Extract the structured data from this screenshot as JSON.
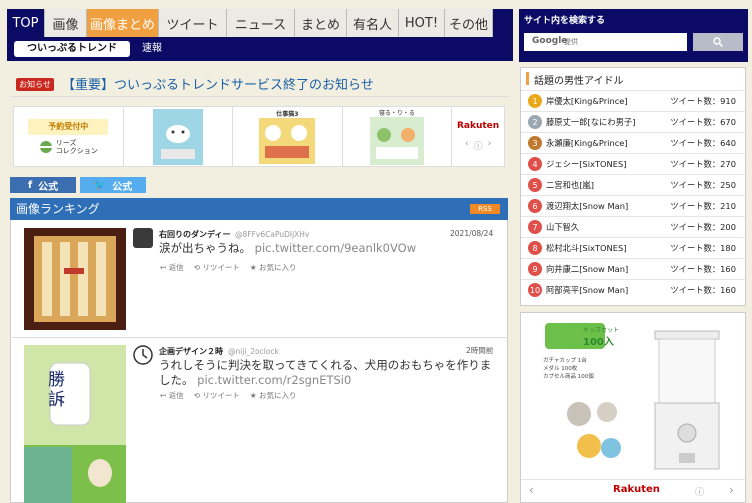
{
  "nav": {
    "tabs": [
      "TOP",
      "画像",
      "画像まとめ",
      "ツイート",
      "ニュース",
      "まとめ",
      "有名人",
      "HOT!",
      "その他"
    ],
    "sub": [
      "ついっぷるトレンド",
      "速報"
    ]
  },
  "notice": {
    "badge": "お知らせ",
    "text": "【重要】ついっぷるトレンドサービス終了のお知らせ"
  },
  "banner": {
    "preorder": "予約受付中",
    "series": "リーズ",
    "collection": "コレクション",
    "rakuten": "Rakuten",
    "card2": "仕事猫3",
    "card4": "寝る・り・る"
  },
  "social": {
    "facebook": "公式",
    "twitter": "公式"
  },
  "ranking": {
    "title": "画像ランキング",
    "rss": "RSS",
    "tweets": [
      {
        "name": "右回りのダンディー",
        "id": "@8FFv6CaPuDIjXHv",
        "date": "2021/08/24",
        "text": "涙が出ちゃうね。",
        "link": "pic.twitter.com/9eanlk0VOw",
        "reply": "返信",
        "retweet": "リツイート",
        "fav": "お気に入り"
      },
      {
        "name": "企画デザイン２時",
        "id": "@niji_2oclock",
        "date": "2時間前",
        "text": "うれしそうに判決を取ってきてくれる、犬用のおもちゃを作りました。",
        "link": "pic.twitter.com/r2sgnETSi0",
        "reply": "返信",
        "retweet": "リツイート",
        "fav": "お気に入り",
        "card_text": "勝訴"
      }
    ]
  },
  "search": {
    "label": "サイト内を検索する",
    "logo": "Google",
    "placeholder": "提供"
  },
  "idols": {
    "title": "話題の男性アイドル",
    "count_label": "ツイート数：",
    "items": [
      {
        "rank": "1",
        "name": "岸優太[King&Prince]",
        "count": "910"
      },
      {
        "rank": "2",
        "name": "藤原丈一郎[なにわ男子]",
        "count": "670"
      },
      {
        "rank": "3",
        "name": "永瀬廉[King&Prince]",
        "count": "640"
      },
      {
        "rank": "4",
        "name": "ジェシー[SixTONES]",
        "count": "270"
      },
      {
        "rank": "5",
        "name": "二宮和也[嵐]",
        "count": "250"
      },
      {
        "rank": "6",
        "name": "渡辺翔太[Snow Man]",
        "count": "210"
      },
      {
        "rank": "7",
        "name": "山下智久",
        "count": "200"
      },
      {
        "rank": "8",
        "name": "松村北斗[SixTONES]",
        "count": "180"
      },
      {
        "rank": "9",
        "name": "向井康二[Snow Man]",
        "count": "160"
      },
      {
        "rank": "10",
        "name": "阿部亮平[Snow Man]",
        "count": "160"
      }
    ],
    "colors": [
      "#e8a81a",
      "#9aa7b0",
      "#c0792e",
      "#e0504a",
      "#e0504a",
      "#e0504a",
      "#e0504a",
      "#e0504a",
      "#e0504a",
      "#e0504a"
    ]
  },
  "ad": {
    "kids_set": "キッズセット",
    "amount": "100入",
    "rakuten": "Rakuten",
    "lines": [
      "ガチャカップ 1台",
      "メダル 100枚",
      "カプセル商品 100個"
    ]
  }
}
